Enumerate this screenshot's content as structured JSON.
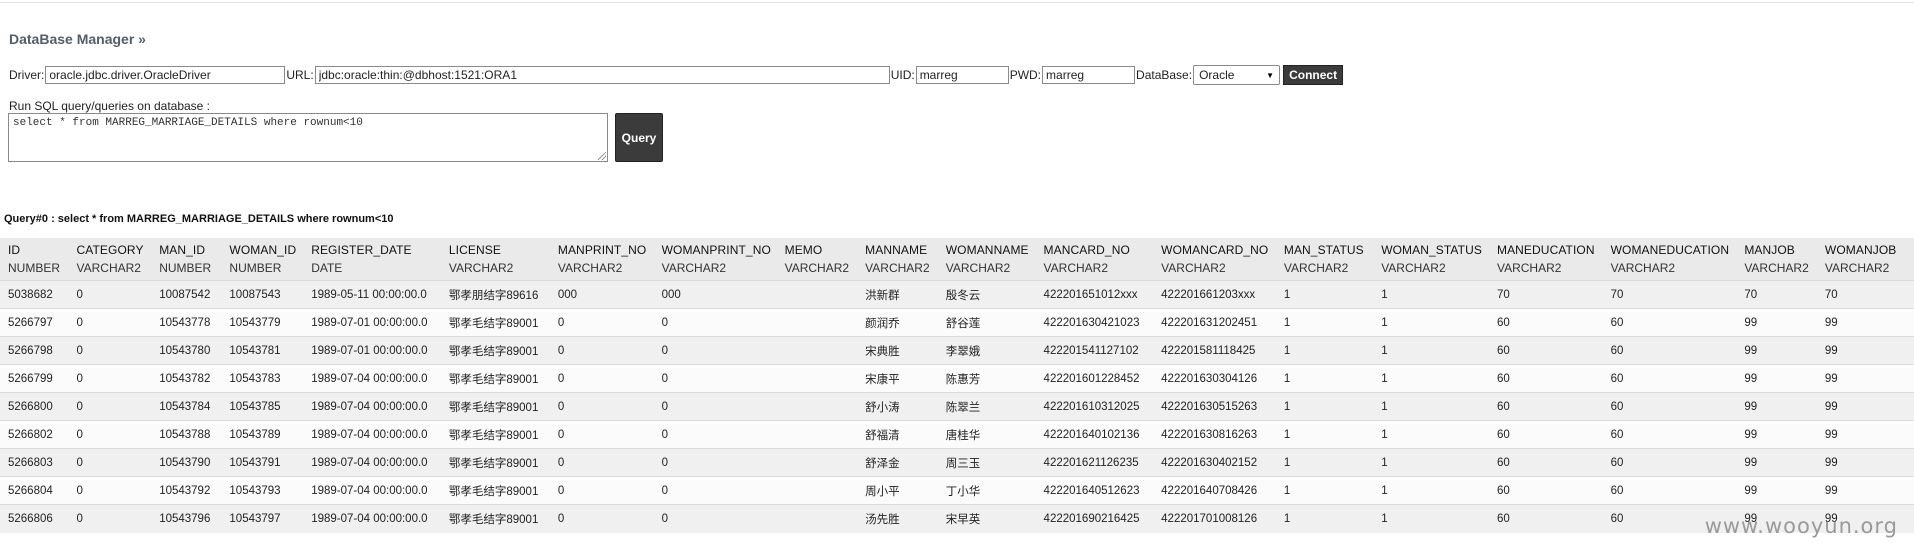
{
  "header": {
    "title": "DataBase Manager »"
  },
  "connection": {
    "driver_label": "Driver:",
    "driver_value": "oracle.jdbc.driver.OracleDriver",
    "url_label": "URL:",
    "url_value": "jdbc:oracle:thin:@dbhost:1521:ORA1",
    "uid_label": "UID:",
    "uid_value": "marreg",
    "pwd_label": "PWD:",
    "pwd_value": "marreg",
    "database_label": "DataBase:",
    "database_selected": "Oracle",
    "connect_label": "Connect"
  },
  "sql": {
    "label": "Run SQL query/queries on database :",
    "query_text": "select * from MARREG_MARRIAGE_DETAILS where rownum<10",
    "query_button": "Query"
  },
  "result": {
    "title": "Query#0 : select * from MARREG_MARRIAGE_DETAILS where rownum<10",
    "columns": [
      {
        "name": "ID",
        "type": "NUMBER"
      },
      {
        "name": "CATEGORY",
        "type": "VARCHAR2"
      },
      {
        "name": "MAN_ID",
        "type": "NUMBER"
      },
      {
        "name": "WOMAN_ID",
        "type": "NUMBER"
      },
      {
        "name": "REGISTER_DATE",
        "type": "DATE"
      },
      {
        "name": "LICENSE",
        "type": "VARCHAR2"
      },
      {
        "name": "MANPRINT_NO",
        "type": "VARCHAR2"
      },
      {
        "name": "WOMANPRINT_NO",
        "type": "VARCHAR2"
      },
      {
        "name": "MEMO",
        "type": "VARCHAR2"
      },
      {
        "name": "MANNAME",
        "type": "VARCHAR2"
      },
      {
        "name": "WOMANNAME",
        "type": "VARCHAR2"
      },
      {
        "name": "MANCARD_NO",
        "type": "VARCHAR2"
      },
      {
        "name": "WOMANCARD_NO",
        "type": "VARCHAR2"
      },
      {
        "name": "MAN_STATUS",
        "type": "VARCHAR2"
      },
      {
        "name": "WOMAN_STATUS",
        "type": "VARCHAR2"
      },
      {
        "name": "MANEDUCATION",
        "type": "VARCHAR2"
      },
      {
        "name": "WOMANEDUCATION",
        "type": "VARCHAR2"
      },
      {
        "name": "MANJOB",
        "type": "VARCHAR2"
      },
      {
        "name": "WOMANJOB",
        "type": "VARCHAR2"
      }
    ],
    "rows": [
      [
        "5038682",
        "0",
        "10087542",
        "10087543",
        "1989-05-11 00:00:00.0",
        "鄂孝朋结字89616",
        "000",
        "000",
        "",
        "洪新群",
        "殷冬云",
        "422201651012xxx",
        "422201661203xxx",
        "1",
        "1",
        "70",
        "70",
        "70",
        "70"
      ],
      [
        "5266797",
        "0",
        "10543778",
        "10543779",
        "1989-07-01 00:00:00.0",
        "鄂孝毛结字89001",
        "0",
        "0",
        "",
        "颜润乔",
        "舒谷莲",
        "422201630421023",
        "422201631202451",
        "1",
        "1",
        "60",
        "60",
        "99",
        "99"
      ],
      [
        "5266798",
        "0",
        "10543780",
        "10543781",
        "1989-07-01 00:00:00.0",
        "鄂孝毛结字89001",
        "0",
        "0",
        "",
        "宋典胜",
        "李翠娥",
        "422201541127102",
        "422201581118425",
        "1",
        "1",
        "60",
        "60",
        "99",
        "99"
      ],
      [
        "5266799",
        "0",
        "10543782",
        "10543783",
        "1989-07-04 00:00:00.0",
        "鄂孝毛结字89001",
        "0",
        "0",
        "",
        "宋康平",
        "陈惠芳",
        "422201601228452",
        "422201630304126",
        "1",
        "1",
        "60",
        "60",
        "99",
        "99"
      ],
      [
        "5266800",
        "0",
        "10543784",
        "10543785",
        "1989-07-04 00:00:00.0",
        "鄂孝毛结字89001",
        "0",
        "0",
        "",
        "舒小涛",
        "陈翠兰",
        "422201610312025",
        "422201630515263",
        "1",
        "1",
        "60",
        "60",
        "99",
        "99"
      ],
      [
        "5266802",
        "0",
        "10543788",
        "10543789",
        "1989-07-04 00:00:00.0",
        "鄂孝毛结字89001",
        "0",
        "0",
        "",
        "舒福清",
        "唐桂华",
        "422201640102136",
        "422201630816263",
        "1",
        "1",
        "60",
        "60",
        "99",
        "99"
      ],
      [
        "5266803",
        "0",
        "10543790",
        "10543791",
        "1989-07-04 00:00:00.0",
        "鄂孝毛结字89001",
        "0",
        "0",
        "",
        "舒泽金",
        "周三玉",
        "422201621126235",
        "422201630402152",
        "1",
        "1",
        "60",
        "60",
        "99",
        "99"
      ],
      [
        "5266804",
        "0",
        "10543792",
        "10543793",
        "1989-07-04 00:00:00.0",
        "鄂孝毛结字89001",
        "0",
        "0",
        "",
        "周小平",
        "丁小华",
        "422201640512623",
        "422201640708426",
        "1",
        "1",
        "60",
        "60",
        "99",
        "99"
      ],
      [
        "5266806",
        "0",
        "10543796",
        "10543797",
        "1989-07-04 00:00:00.0",
        "鄂孝毛结字89001",
        "0",
        "0",
        "",
        "汤先胜",
        "宋早英",
        "422201690216425",
        "422201701008126",
        "1",
        "1",
        "60",
        "60",
        "99",
        "99"
      ]
    ]
  },
  "watermark": "www.wooyun.org"
}
